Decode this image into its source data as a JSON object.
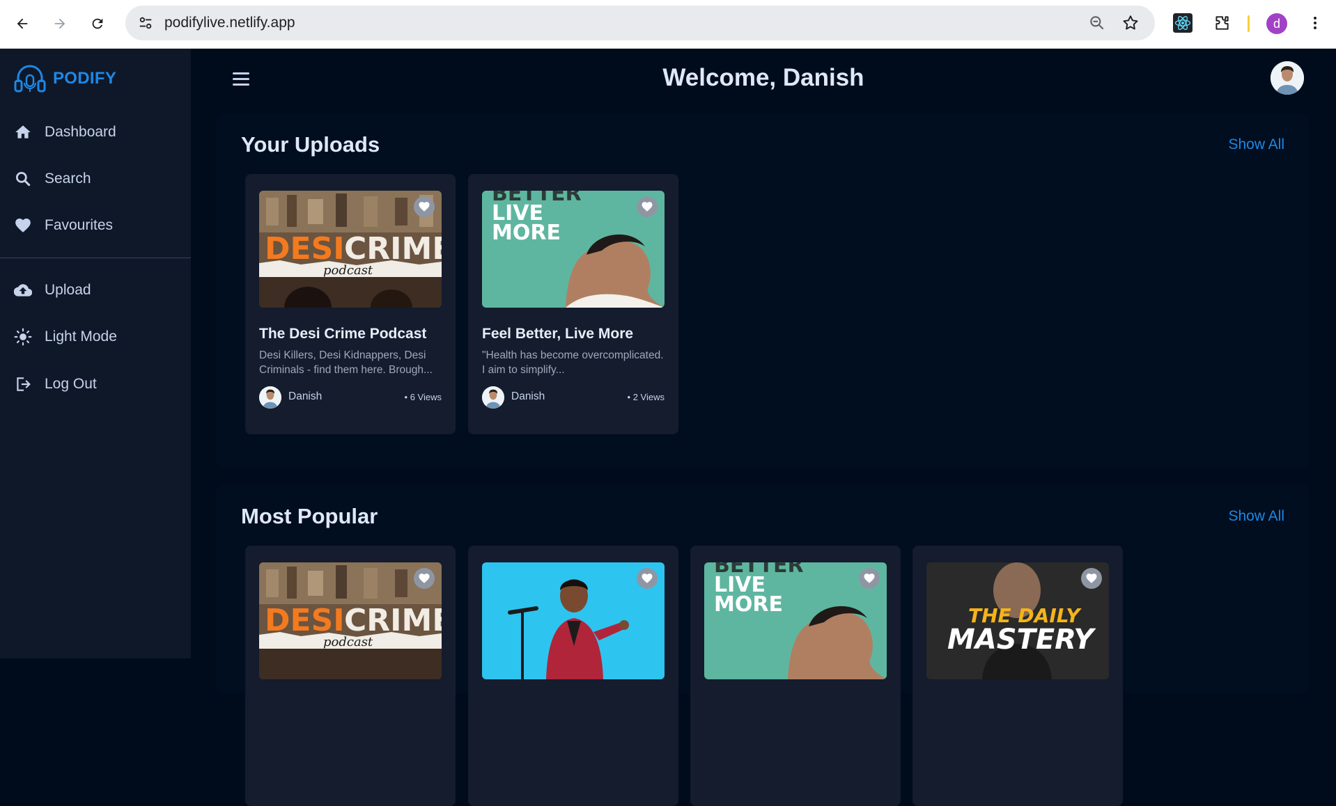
{
  "browser": {
    "url": "podifylive.netlify.app",
    "profile_initial": "d"
  },
  "app": {
    "logo_text": "PODIFY",
    "welcome": "Welcome, Danish"
  },
  "sidebar": {
    "items": [
      {
        "label": "Dashboard",
        "icon": "home-icon"
      },
      {
        "label": "Search",
        "icon": "search-icon"
      },
      {
        "label": "Favourites",
        "icon": "heart-icon"
      },
      {
        "label": "Upload",
        "icon": "cloud-upload-icon"
      },
      {
        "label": "Light Mode",
        "icon": "sun-icon"
      },
      {
        "label": "Log Out",
        "icon": "logout-icon"
      }
    ]
  },
  "uploads": {
    "title": "Your Uploads",
    "show_all": "Show All",
    "cards": [
      {
        "title": "The Desi Crime Podcast",
        "description": "Desi Killers, Desi Kidnappers, Desi Criminals - find them here. Brough...",
        "author": "Danish",
        "views": "• 6 Views",
        "thumb_text": "DESI CRIME",
        "thumb_sub": "podcast"
      },
      {
        "title": "Feel Better, Live More",
        "description": "\"Health has become overcomplicated. I aim to simplify...",
        "author": "Danish",
        "views": "• 2 Views",
        "thumb_text": "BETTER\nLIVE\nMORE"
      }
    ]
  },
  "popular": {
    "title": "Most Popular",
    "show_all": "Show All",
    "cards": [
      {
        "thumb_text": "DESI CRIME",
        "thumb_sub": "podcast"
      },
      {
        "thumb_text": ""
      },
      {
        "thumb_text": "BETTER\nLIVE\nMORE"
      },
      {
        "thumb_text": "THE DAILY",
        "thumb_sub": "MASTERY"
      }
    ]
  },
  "colors": {
    "accent": "#1e88e5",
    "background": "#000c1c",
    "sidebar": "#0f1829",
    "card": "#141c2d"
  }
}
